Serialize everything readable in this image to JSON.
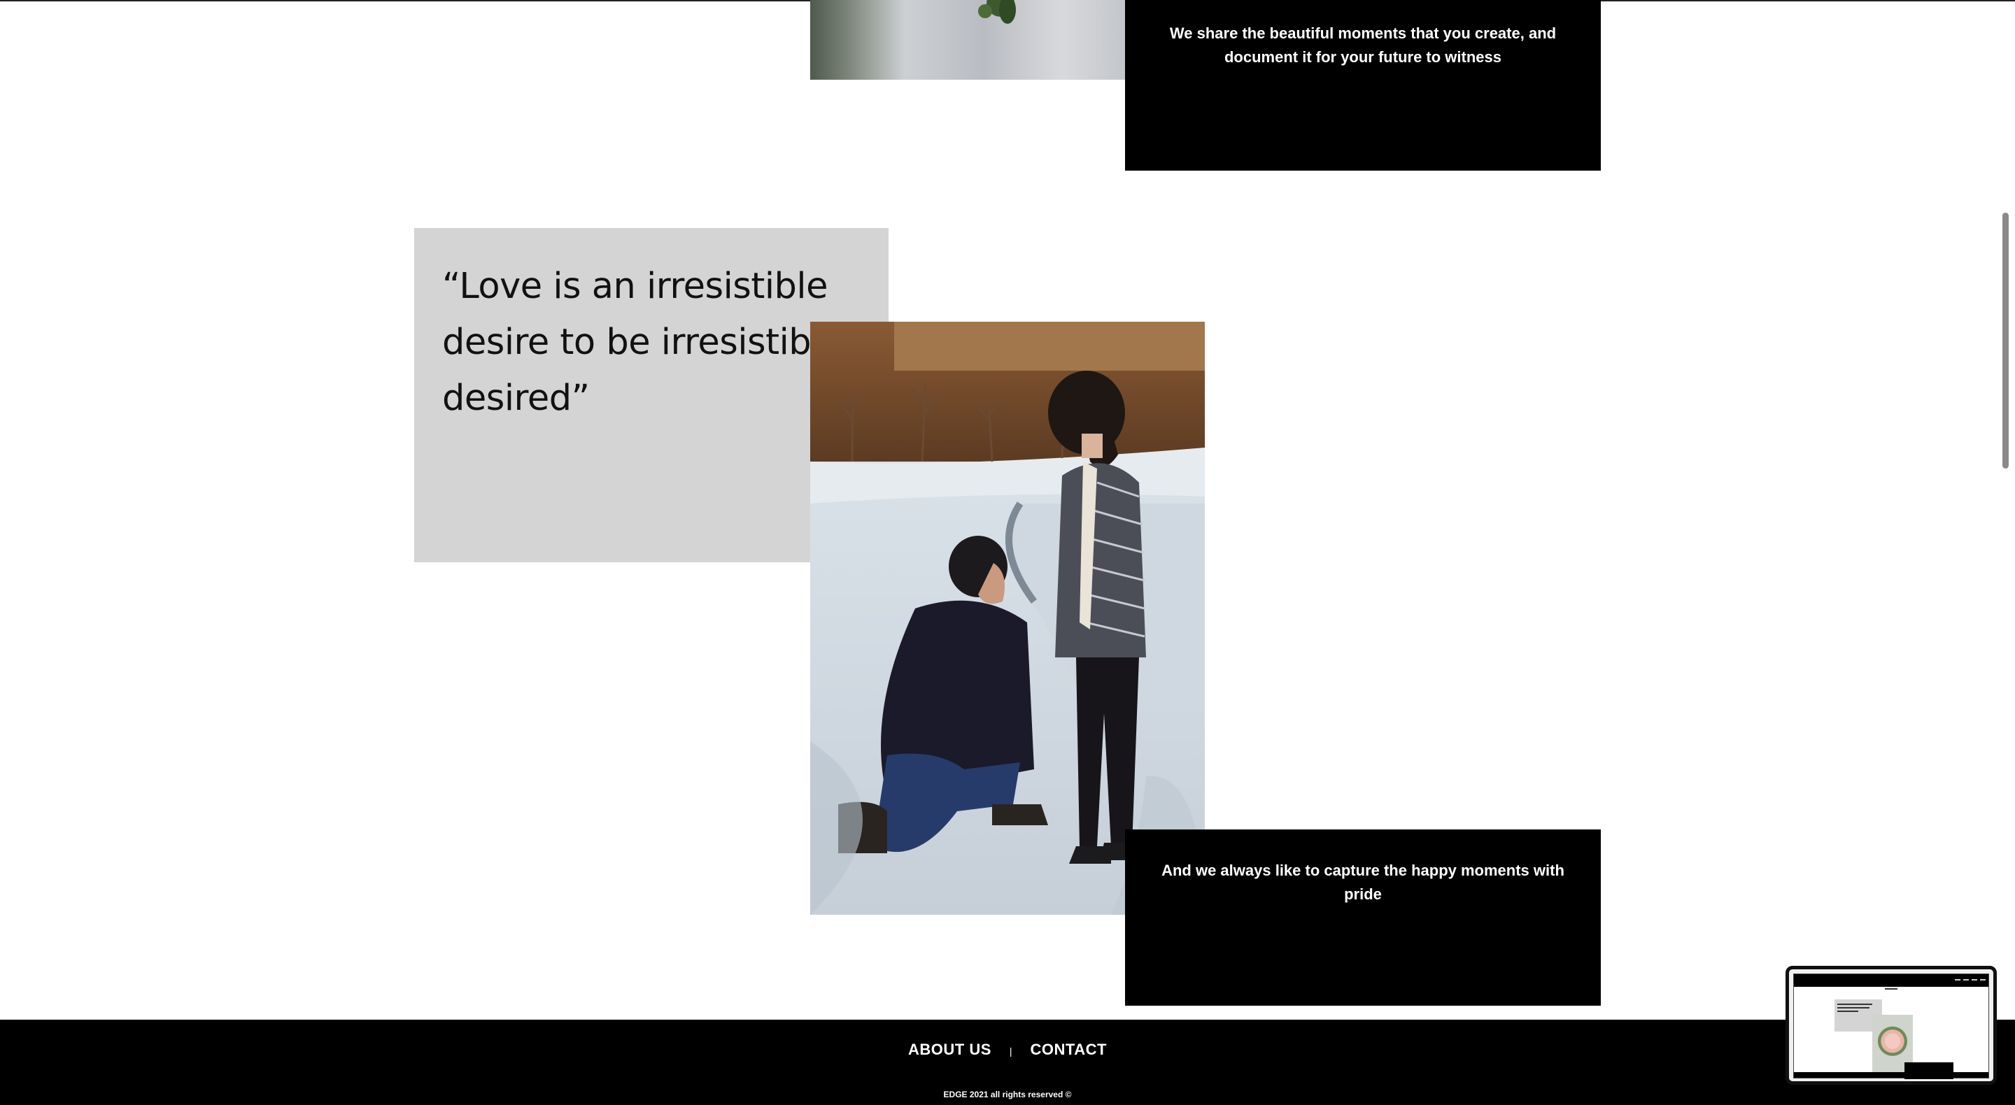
{
  "captions": {
    "top": "We share the beautiful moments that you create, and document it for your future to witness",
    "bottom": "And we always like to capture the happy moments with pride"
  },
  "quote": {
    "text": "“Love is an irresistible desire to be irresistibly desired”"
  },
  "footer": {
    "nav": {
      "about": "ABOUT US",
      "separator": "|",
      "contact": "CONTACT"
    },
    "copyright": "EDGE 2021 all rights reserved ©"
  }
}
